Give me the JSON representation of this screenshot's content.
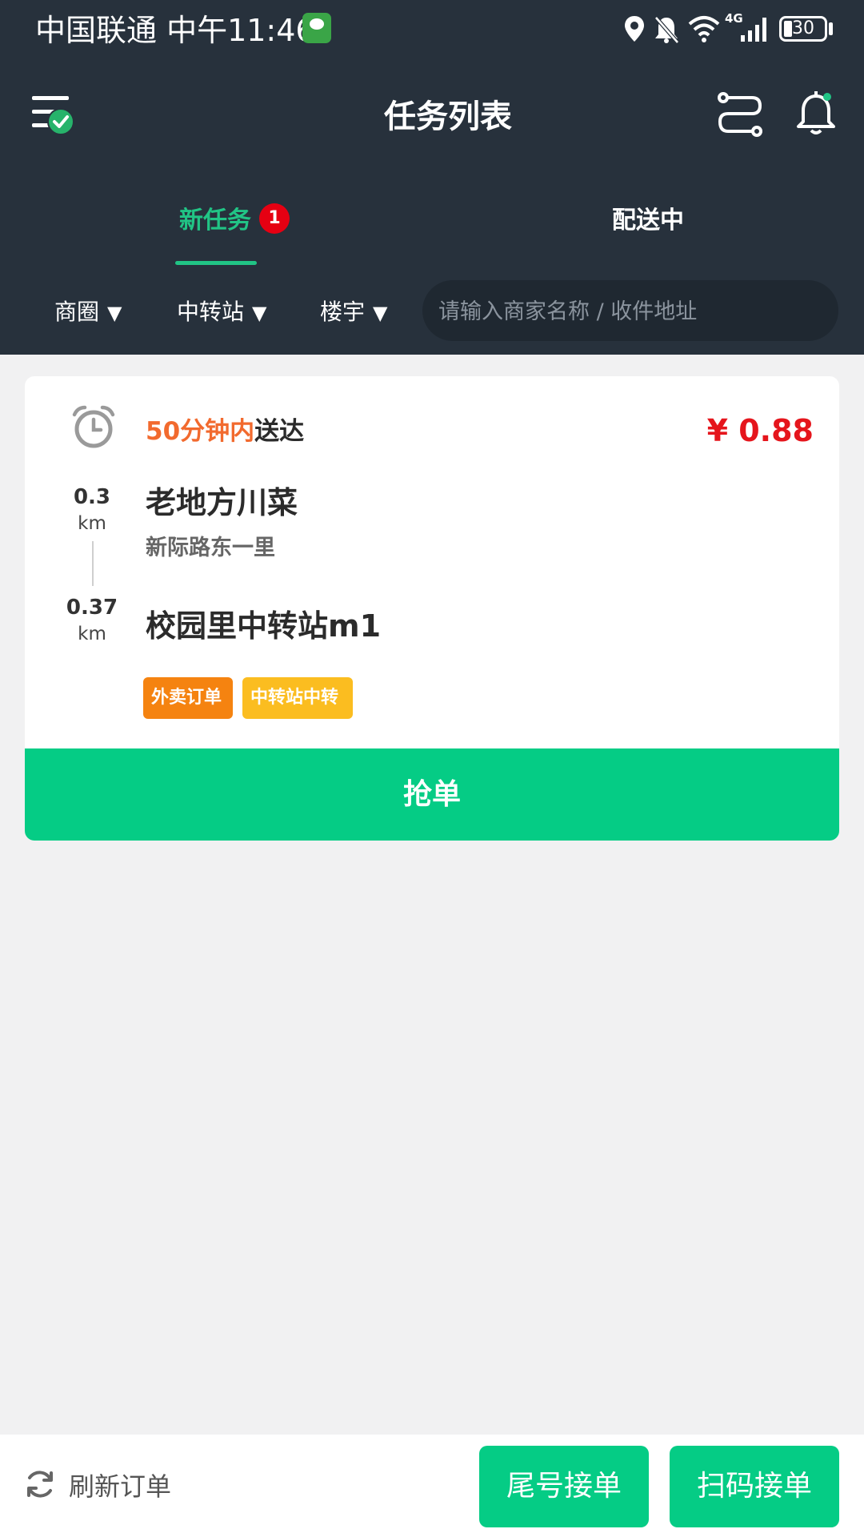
{
  "status_bar": {
    "carrier_time": "中国联通 中午11:46",
    "battery": "30",
    "network": "4G"
  },
  "topbar": {
    "title": "任务列表",
    "icons": [
      "menu-check-icon",
      "route-icon",
      "bell-icon"
    ]
  },
  "tabs": [
    {
      "label": "新任务",
      "badge": "1",
      "active": true
    },
    {
      "label": "配送中",
      "active": false
    }
  ],
  "filters": [
    {
      "label": "商圈"
    },
    {
      "label": "中转站"
    },
    {
      "label": "楼宇"
    }
  ],
  "search": {
    "placeholder": "请输入商家名称 / 收件地址",
    "value": ""
  },
  "task": {
    "deadline_highlight": "50分钟内",
    "deadline_suffix": "送达",
    "price": "¥ 0.88",
    "pickup": {
      "distance": "0.3",
      "unit": "km",
      "name": "老地方川菜",
      "address": "新际路东一里"
    },
    "dropoff": {
      "distance": "0.37",
      "unit": "km",
      "name": "校园里中转站m1"
    },
    "tags": [
      "外卖订单",
      "中转站中转"
    ],
    "grab_label": "抢单"
  },
  "bottom": {
    "refresh_label": "刷新订单",
    "tail_button": "尾号接单",
    "scan_button": "扫码接单"
  },
  "colors": {
    "header_bg": "#27313c",
    "accent_green": "#05cc85",
    "price_red": "#e5151c",
    "deadline_orange": "#f26a2e"
  }
}
